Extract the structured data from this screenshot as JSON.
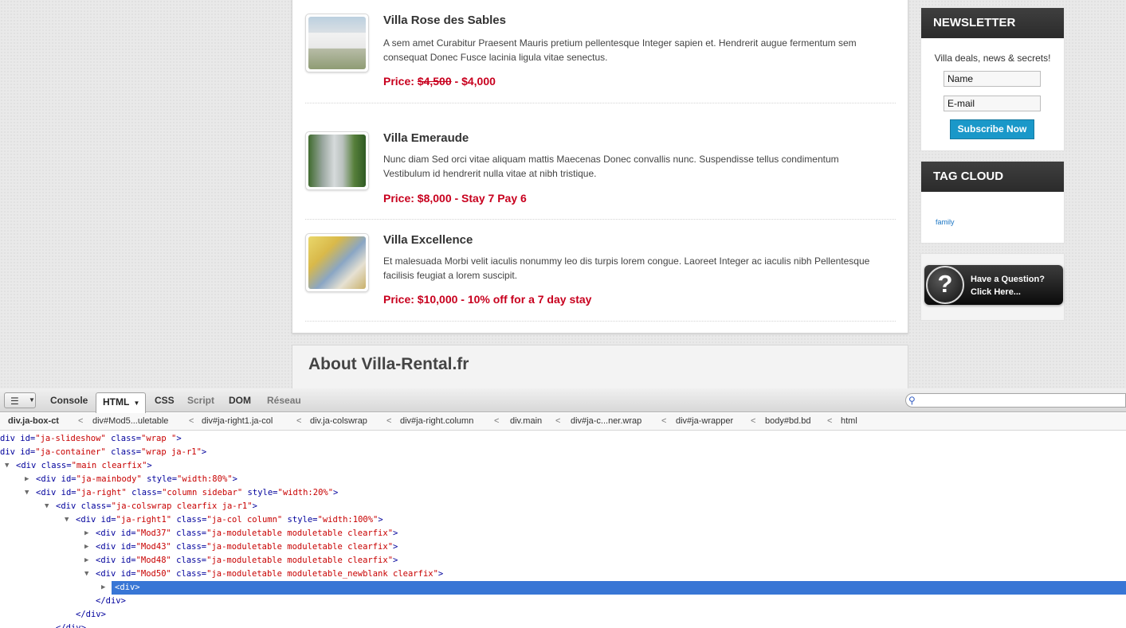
{
  "villas": [
    {
      "title": "Villa Rose des Sables",
      "description": "A sem amet Curabitur Praesent Mauris pretium pellentesque Integer sapien et. Hendrerit augue fermentum sem consequat Donec Fusce lacinia ligula vitae senectus.",
      "price_prefix": "Price:",
      "price_old": "$4,500",
      "price_sep": " - ",
      "price_new": "$4,000"
    },
    {
      "title": "Villa Emeraude",
      "description": "Nunc diam Sed orci vitae aliquam mattis Maecenas Donec convallis nunc. Suspendisse tellus condimentum Vestibulum id hendrerit nulla vitae at nibh tristique.",
      "price": "Price: $8,000 - Stay 7 Pay 6"
    },
    {
      "title": "Villa Excellence",
      "description": "Et malesuada Morbi velit iaculis nonummy leo dis turpis lorem congue. Laoreet Integer ac iaculis nibh Pellentesque facilisis feugiat a lorem suscipit.",
      "price": "Price: $10,000 - 10% off for a 7 day stay"
    }
  ],
  "about_title": "About Villa-Rental.fr",
  "newsletter": {
    "heading": "NEWSLETTER",
    "tagline": "Villa deals, news & secrets!",
    "name_value": "Name",
    "email_value": "E-mail",
    "subscribe_label": "Subscribe Now"
  },
  "tagcloud": {
    "heading": "TAG CLOUD",
    "tags": [
      "family"
    ]
  },
  "question_banner": {
    "line1": "Have a Question?",
    "line2": "Click Here...",
    "glyph": "?"
  },
  "devtools": {
    "tabs": {
      "console": "Console",
      "html": "HTML",
      "css": "CSS",
      "script": "Script",
      "dom": "DOM",
      "network": "Réseau"
    },
    "breadcrumbs": [
      "div.ja-box-ct",
      "div#Mod5...uletable",
      "div#ja-right1.ja-col",
      "div.ja-colswrap",
      "div#ja-right.column",
      "div.main",
      "div#ja-c...ner.wrap",
      "div#ja-wrapper",
      "body#bd.bd",
      "html"
    ],
    "crumb_separator": "<",
    "tree": [
      {
        "open": "div",
        "attrs": [
          [
            "id",
            "ja-slideshow"
          ],
          [
            "class",
            "wrap "
          ]
        ],
        "close": ">"
      },
      {
        "open": "div",
        "attrs": [
          [
            "id",
            "ja-container"
          ],
          [
            "class",
            "wrap ja-r1"
          ]
        ],
        "close": ">"
      },
      {
        "open": "<div",
        "attrs": [
          [
            "class",
            "main clearfix"
          ]
        ],
        "close": ">"
      },
      {
        "open": "<div",
        "attrs": [
          [
            "id",
            "ja-mainbody"
          ],
          [
            "style",
            "width:80%"
          ]
        ],
        "close": ">"
      },
      {
        "open": "<div",
        "attrs": [
          [
            "id",
            "ja-right"
          ],
          [
            "class",
            "column sidebar"
          ],
          [
            "style",
            "width:20%"
          ]
        ],
        "close": ">"
      },
      {
        "open": "<div",
        "attrs": [
          [
            "class",
            "ja-colswrap clearfix ja-r1"
          ]
        ],
        "close": ">"
      },
      {
        "open": "<div",
        "attrs": [
          [
            "id",
            "ja-right1"
          ],
          [
            "class",
            "ja-col column"
          ],
          [
            "style",
            "width:100%"
          ]
        ],
        "close": ">"
      },
      {
        "open": "<div",
        "attrs": [
          [
            "id",
            "Mod37"
          ],
          [
            "class",
            "ja-moduletable moduletable clearfix"
          ]
        ],
        "close": ">"
      },
      {
        "open": "<div",
        "attrs": [
          [
            "id",
            "Mod43"
          ],
          [
            "class",
            "ja-moduletable moduletable clearfix"
          ]
        ],
        "close": ">"
      },
      {
        "open": "<div",
        "attrs": [
          [
            "id",
            "Mod48"
          ],
          [
            "class",
            "ja-moduletable moduletable clearfix"
          ]
        ],
        "close": ">"
      },
      {
        "open": "<div",
        "attrs": [
          [
            "id",
            "Mod50"
          ],
          [
            "class",
            "ja-moduletable moduletable_newblank clearfix"
          ]
        ],
        "close": ">"
      },
      {
        "open": "<div>",
        "attrs": [],
        "close": ""
      },
      {
        "open": "</div>",
        "attrs": [],
        "close": ""
      },
      {
        "open": "</div>",
        "attrs": [],
        "close": ""
      },
      {
        "open": "</div>",
        "attrs": [],
        "close": ""
      }
    ]
  },
  "colors": {
    "price_red": "#c8001e",
    "subscribe_blue": "#1a98c9",
    "selection_blue": "#3876d5"
  }
}
